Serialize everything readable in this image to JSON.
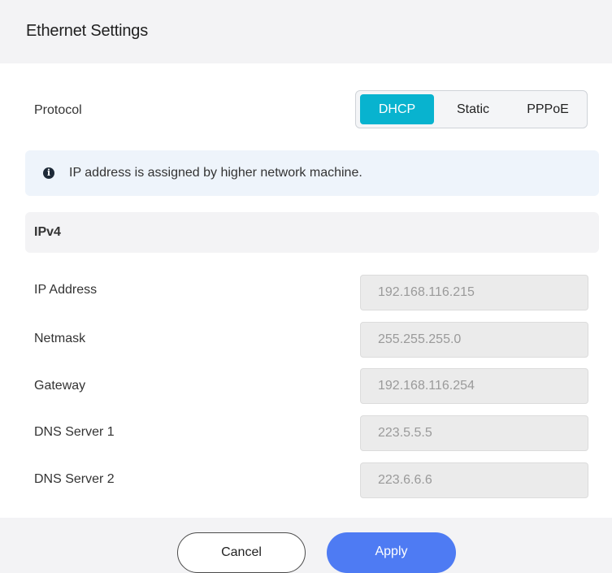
{
  "dialog": {
    "title": "Ethernet Settings"
  },
  "protocol": {
    "label": "Protocol",
    "options": [
      "DHCP",
      "Static",
      "PPPoE"
    ],
    "selected": "DHCP"
  },
  "info": {
    "icon": "info-icon",
    "glyph": "i",
    "message": "IP address is assigned by higher network machine."
  },
  "ipv4": {
    "section_title": "IPv4",
    "fields": [
      {
        "label": "IP Address",
        "value": "192.168.116.215"
      },
      {
        "label": "Netmask",
        "value": "255.255.255.0"
      },
      {
        "label": "Gateway",
        "value": "192.168.116.254"
      },
      {
        "label": "DNS Server 1",
        "value": "223.5.5.5"
      },
      {
        "label": "DNS Server 2",
        "value": "223.6.6.6"
      }
    ]
  },
  "footer": {
    "cancel_label": "Cancel",
    "apply_label": "Apply"
  },
  "colors": {
    "accent": "#08b3cf",
    "primary_button": "#4e7bf3",
    "info_background": "#eef4fb"
  }
}
